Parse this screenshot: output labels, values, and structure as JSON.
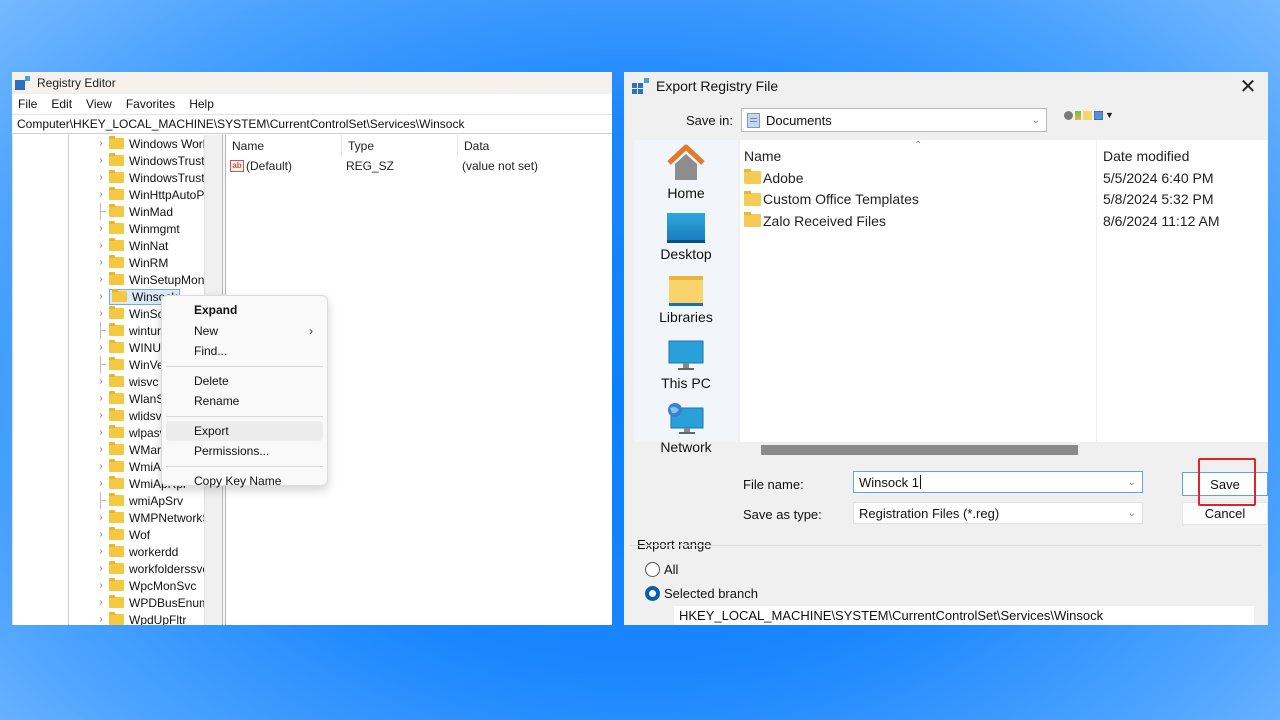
{
  "registry_editor": {
    "title": "Registry Editor",
    "menu": [
      "File",
      "Edit",
      "View",
      "Favorites",
      "Help"
    ],
    "address": "Computer\\HKEY_LOCAL_MACHINE\\SYSTEM\\CurrentControlSet\\Services\\Winsock",
    "tree_items": [
      {
        "label": "Windows Work",
        "expandable": true
      },
      {
        "label": "WindowsTruste",
        "expandable": true
      },
      {
        "label": "WindowsTruste",
        "expandable": true
      },
      {
        "label": "WinHttpAutoP",
        "expandable": true
      },
      {
        "label": "WinMad",
        "expandable": false
      },
      {
        "label": "Winmgmt",
        "expandable": true
      },
      {
        "label": "WinNat",
        "expandable": true
      },
      {
        "label": "WinRM",
        "expandable": true
      },
      {
        "label": "WinSetupMon",
        "expandable": true
      },
      {
        "label": "Winsock",
        "expandable": true,
        "selected": true
      },
      {
        "label": "WinSc",
        "expandable": true
      },
      {
        "label": "wintur",
        "expandable": false
      },
      {
        "label": "WINU",
        "expandable": true
      },
      {
        "label": "WinVe",
        "expandable": false
      },
      {
        "label": "wisvc",
        "expandable": true
      },
      {
        "label": "WlanS",
        "expandable": true
      },
      {
        "label": "wlidsv",
        "expandable": true
      },
      {
        "label": "wlpasv",
        "expandable": true
      },
      {
        "label": "WMar",
        "expandable": true
      },
      {
        "label": "WmiA",
        "expandable": true
      },
      {
        "label": "WmiApRpl",
        "expandable": true
      },
      {
        "label": "wmiApSrv",
        "expandable": false
      },
      {
        "label": "WMPNetworkS",
        "expandable": true
      },
      {
        "label": "Wof",
        "expandable": true
      },
      {
        "label": "workerdd",
        "expandable": true
      },
      {
        "label": "workfolderssvc",
        "expandable": true
      },
      {
        "label": "WpcMonSvc",
        "expandable": true
      },
      {
        "label": "WPDBusEnum",
        "expandable": true
      },
      {
        "label": "WpdUpFltr",
        "expandable": true
      }
    ],
    "values_header": {
      "name": "Name",
      "type": "Type",
      "data": "Data"
    },
    "values": [
      {
        "name": "(Default)",
        "type": "REG_SZ",
        "data": "(value not set)",
        "icon": "string-value-icon"
      }
    ],
    "context_menu": {
      "items": [
        {
          "label": "Expand",
          "bold": true
        },
        {
          "label": "New",
          "submenu": true
        },
        {
          "label": "Find..."
        },
        {
          "separator": true
        },
        {
          "label": "Delete"
        },
        {
          "label": "Rename"
        },
        {
          "separator": true
        },
        {
          "label": "Export",
          "hovered": true
        },
        {
          "label": "Permissions..."
        },
        {
          "separator": true
        },
        {
          "label": "Copy Key Name"
        }
      ]
    }
  },
  "export_dialog": {
    "title": "Export Registry File",
    "close_glyph": "✕",
    "save_in_label": "Save in:",
    "save_in_value": "Documents",
    "places": [
      "Home",
      "Desktop",
      "Libraries",
      "This PC",
      "Network"
    ],
    "columns": {
      "name": "Name",
      "date": "Date modified"
    },
    "files": [
      {
        "name": "Adobe",
        "date": "5/5/2024 6:40 PM"
      },
      {
        "name": "Custom Office Templates",
        "date": "5/8/2024 5:32 PM"
      },
      {
        "name": "Zalo Received Files",
        "date": "8/6/2024 11:12 AM"
      }
    ],
    "file_name_label": "File name:",
    "file_name_value": "Winsock 1",
    "save_type_label": "Save as type:",
    "save_type_value": "Registration Files (*.reg)",
    "save_button": "Save",
    "cancel_button": "Cancel",
    "export_range_label": "Export range",
    "range_all": "All",
    "range_selected": "Selected branch",
    "range_selected_checked": true,
    "branch_path": "HKEY_LOCAL_MACHINE\\SYSTEM\\CurrentControlSet\\Services\\Winsock",
    "highlight_color": "#d8262d"
  }
}
